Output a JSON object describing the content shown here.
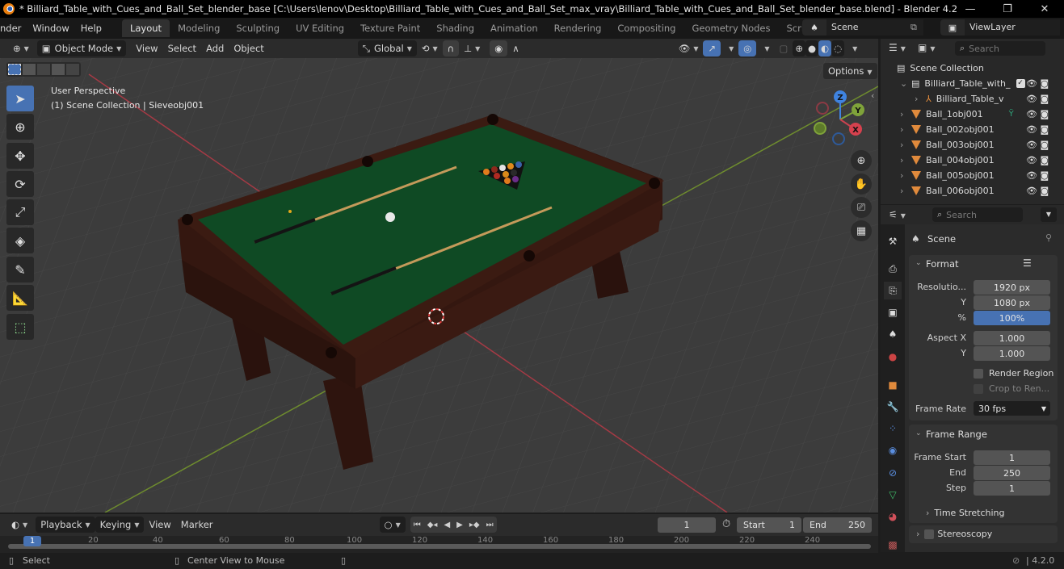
{
  "window": {
    "title": "* Billiard_Table_with_Cues_and_Ball_Set_blender_base [C:\\Users\\lenov\\Desktop\\Billiard_Table_with_Cues_and_Ball_Set_max_vray\\Billiard_Table_with_Cues_and_Ball_Set_blender_base.blend] - Blender 4.2",
    "minimize": "—",
    "maximize": "❐",
    "close": "✕"
  },
  "menu": {
    "items": [
      "nder",
      "Window",
      "Help"
    ],
    "workspaces": [
      "Layout",
      "Modeling",
      "Sculpting",
      "UV Editing",
      "Texture Paint",
      "Shading",
      "Animation",
      "Rendering",
      "Compositing",
      "Geometry Nodes",
      "Scripting"
    ],
    "active_workspace": "Layout",
    "add_workspace": "+",
    "scene_label": "Scene",
    "viewlayer_label": "ViewLayer"
  },
  "viewport_header": {
    "mode": "Object Mode",
    "menus": [
      "View",
      "Select",
      "Add",
      "Object"
    ],
    "transform_orientation": "Global",
    "options": "Options"
  },
  "viewport": {
    "perspective": "User Perspective",
    "collection_info": "(1) Scene Collection | Sieveobj001",
    "gizmo": {
      "z": "Z",
      "y": "Y",
      "x": "X"
    },
    "colors": {
      "x_axis": "#c8424f",
      "y_axis": "#7fa33a",
      "z_axis": "#3f83e0",
      "felt": "#0f4a24",
      "wood": "#3a1a13"
    }
  },
  "tools": [
    "select-box",
    "cursor",
    "move",
    "rotate",
    "scale",
    "transform",
    "annotate",
    "measure",
    "add-cube"
  ],
  "outliner": {
    "search_placeholder": "Search",
    "root": "Scene Collection",
    "items": [
      {
        "label": "Billiard_Table_with_",
        "type": "collection",
        "indent": 1
      },
      {
        "label": "Billiard_Table_v",
        "type": "empty",
        "indent": 2
      },
      {
        "label": "Ball_1obj001",
        "type": "mesh",
        "indent": 1
      },
      {
        "label": "Ball_002obj001",
        "type": "mesh",
        "indent": 1
      },
      {
        "label": "Ball_003obj001",
        "type": "mesh",
        "indent": 1
      },
      {
        "label": "Ball_004obj001",
        "type": "mesh",
        "indent": 1
      },
      {
        "label": "Ball_005obj001",
        "type": "mesh",
        "indent": 1
      },
      {
        "label": "Ball_006obj001",
        "type": "mesh",
        "indent": 1
      }
    ]
  },
  "properties": {
    "search_placeholder": "Search",
    "context": "Scene",
    "format": {
      "title": "Format",
      "resolution_label": "Resolutio...",
      "resolution_x": "1920 px",
      "y_label": "Y",
      "resolution_y": "1080 px",
      "pct_label": "%",
      "resolution_pct": "100%",
      "aspect_x_label": "Aspect X",
      "aspect_x": "1.000",
      "aspect_y_label": "Y",
      "aspect_y": "1.000",
      "render_region": "Render Region",
      "crop": "Crop to Ren...",
      "frame_rate_label": "Frame Rate",
      "frame_rate": "30 fps"
    },
    "frame_range": {
      "title": "Frame Range",
      "start_label": "Frame Start",
      "start": "1",
      "end_label": "End",
      "end": "250",
      "step_label": "Step",
      "step": "1",
      "time_stretching": "Time Stretching"
    },
    "stereoscopy": "Stereoscopy"
  },
  "timeline": {
    "menus": [
      "Playback",
      "Keying",
      "View",
      "Marker"
    ],
    "current_frame": "1",
    "start_label": "Start",
    "start": "1",
    "end_label": "End",
    "end": "250",
    "ticks": [
      "20",
      "40",
      "60",
      "80",
      "100",
      "120",
      "140",
      "160",
      "180",
      "200",
      "220",
      "240"
    ],
    "playhead": "1"
  },
  "statusbar": {
    "select": "Select",
    "center_view": "Center View to Mouse",
    "version": "4.2.0"
  }
}
